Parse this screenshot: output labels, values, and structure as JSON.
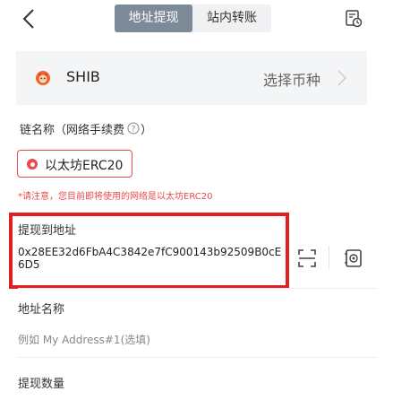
{
  "header": {
    "tabs": [
      {
        "label": "地址提现",
        "active": true
      },
      {
        "label": "站内转账",
        "active": false
      }
    ]
  },
  "coin": {
    "name": "SHIB",
    "choose_label": "选择币种"
  },
  "chain": {
    "label": "链名称（网络手续费",
    "label_close": "）",
    "selected": "以太坊ERC20",
    "warning": "*请注意，您目前即将使用的网络是以太坊ERC20"
  },
  "withdraw_address": {
    "label": "提现到地址",
    "value": "0x28EE32d6FbA4C3842e7fC900143b92509B0cE6D5"
  },
  "address_name": {
    "label": "地址名称",
    "placeholder": "例如 My Address#1(选填)"
  },
  "amount": {
    "label": "提现数量"
  },
  "colors": {
    "accent_red": "#e94b4b",
    "active_tab": "#7d8a98",
    "highlight_box": "#e02020"
  }
}
